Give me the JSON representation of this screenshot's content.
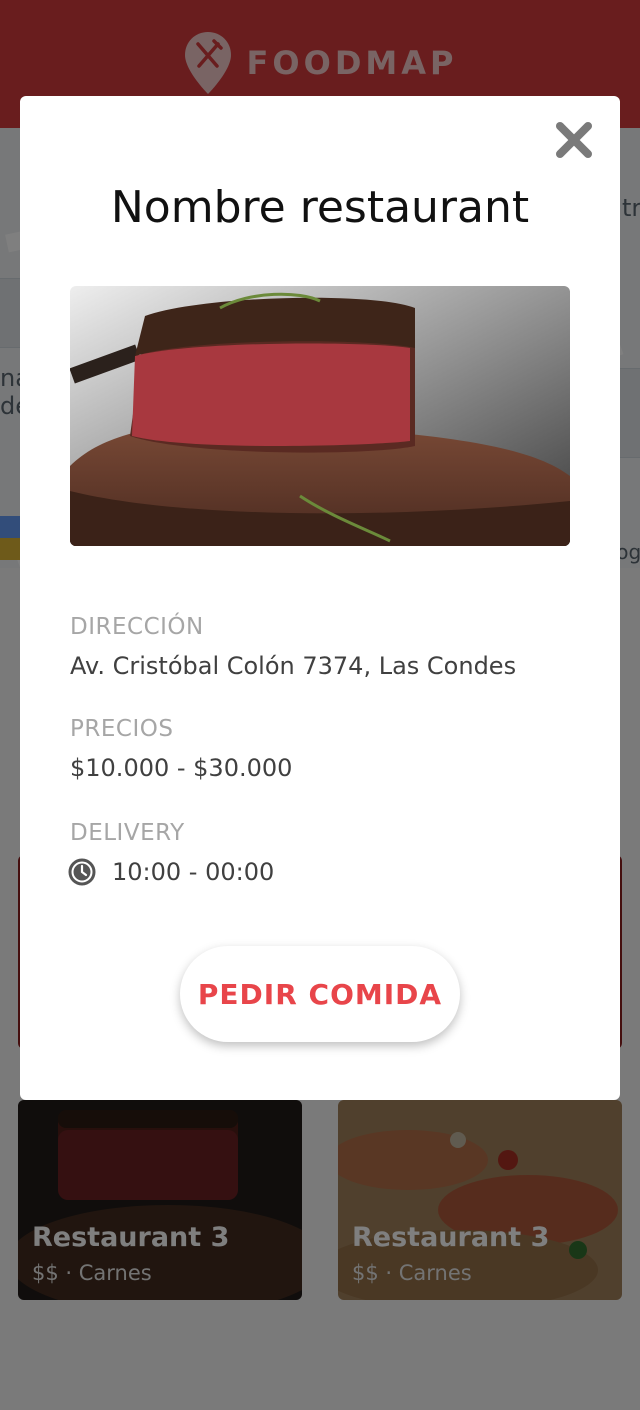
{
  "header": {
    "brand": "FOODMAP",
    "logo_icon": "map-pin-fork-knife-icon"
  },
  "colors": {
    "brand_red": "#d33a3c",
    "accent_red": "#e8454a"
  },
  "map": {
    "fragments": [
      "tr",
      "na",
      "de",
      "oog"
    ]
  },
  "cards": [
    {
      "name": "Restaurant 3",
      "meta": "$$ · Carnes",
      "image": "steak"
    },
    {
      "name": "Restaurant 3",
      "meta": "$$ · Carnes",
      "image": "shrimp-paella"
    }
  ],
  "modal": {
    "title": "Nombre restaurant",
    "close_icon": "close-icon",
    "photo": "steak",
    "address_label": "DIRECCIÓN",
    "address": "Av. Cristóbal Colón 7374, Las Condes",
    "prices_label": "PRECIOS",
    "prices": "$10.000 - $30.000",
    "delivery_label": "DELIVERY",
    "delivery_icon": "clock-icon",
    "delivery_hours": "10:00 - 00:00",
    "order_button": "PEDIR COMIDA"
  }
}
